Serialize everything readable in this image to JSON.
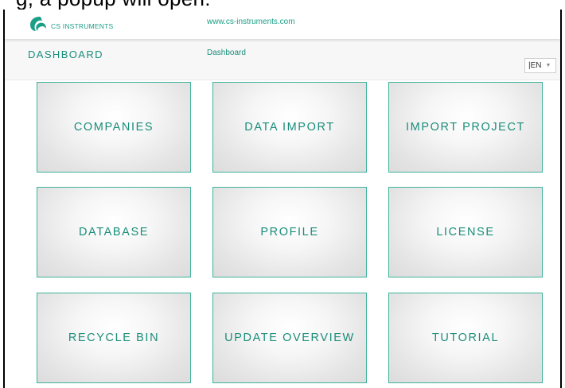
{
  "top_caption": "g, a popup will open:",
  "header": {
    "logo_text": "CS INSTRUMENTS",
    "website": "www.cs-instruments.com"
  },
  "subheader": {
    "title": "DASHBOARD",
    "breadcrumb": "Dashboard",
    "language": "|EN"
  },
  "tiles": [
    {
      "label": "COMPANIES"
    },
    {
      "label": "DATA IMPORT"
    },
    {
      "label": "IMPORT PROJECT"
    },
    {
      "label": "DATABASE"
    },
    {
      "label": "PROFILE"
    },
    {
      "label": "LICENSE"
    },
    {
      "label": "RECYCLE BIN"
    },
    {
      "label": "UPDATE OVERVIEW"
    },
    {
      "label": "TUTORIAL"
    }
  ],
  "colors": {
    "accent": "#1a9e86",
    "tile_border": "#3fb39a"
  },
  "icons": {
    "logo": "cs-instruments-logo-icon",
    "dropdown": "chevron-down-icon"
  }
}
